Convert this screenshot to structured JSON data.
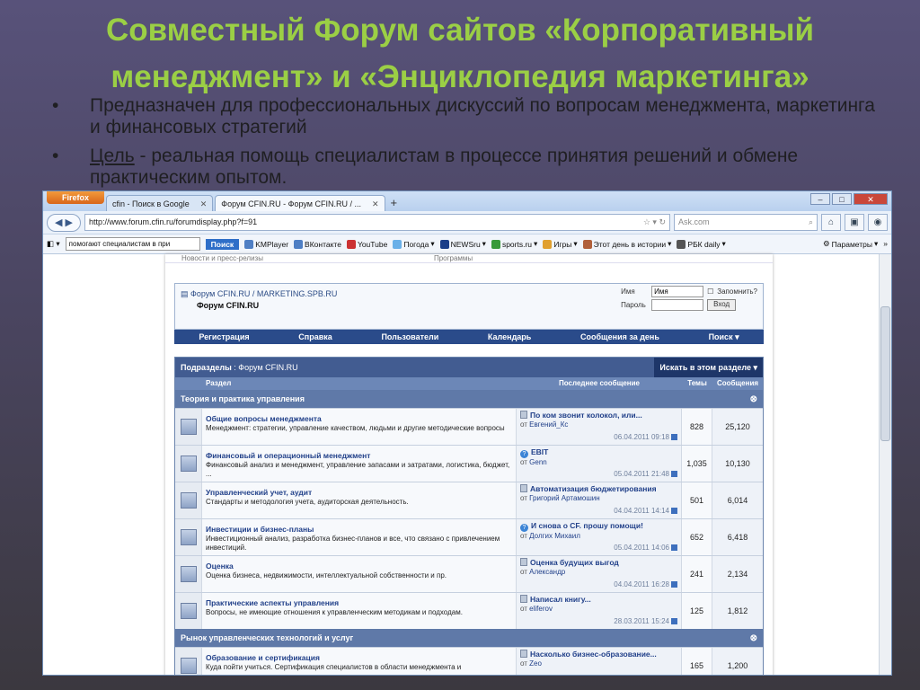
{
  "slide": {
    "title_line1": "Совместный Форум сайтов «Корпоративный",
    "title_line2": "менеджмент» и «Энциклопедия маркетинга»",
    "bullet1": "Предназначен для профессиональных дискуссий по вопросам менеджмента, маркетинга и финансовых стратегий",
    "bullet2_label": "Цель",
    "bullet2_text": " - реальная помощь специалистам в процессе принятия решений и обмене практическим опытом."
  },
  "browser": {
    "firefox_label": "Firefox",
    "tabs": [
      {
        "label": "cfin - Поиск в Google"
      },
      {
        "label": "Форум CFIN.RU - Форум CFIN.RU / ..."
      }
    ],
    "url": "http://www.forum.cfin.ru/forumdisplay.php?f=91",
    "search_placeholder": "Ask.com",
    "toolbar": {
      "search_value": "помогают специалистам в при",
      "search_button": "Поиск",
      "items": [
        "KMPlayer",
        "ВКонтакте",
        "YouTube",
        "Погода",
        "NEWSru",
        "sports.ru",
        "Игры",
        "Этот день в истории",
        "РБК daily"
      ],
      "params": "Параметры"
    }
  },
  "forum": {
    "top_tabs": [
      "Новости и пресс-релизы",
      "Программы"
    ],
    "path": "Форум CFIN.RU / MARKETING.SPB.RU",
    "current": "Форум CFIN.RU",
    "login": {
      "name_label": "Имя",
      "name_value": "Имя",
      "remember": "Запомнить?",
      "pass_label": "Пароль",
      "button": "Вход"
    },
    "menu": [
      "Регистрация",
      "Справка",
      "Пользователи",
      "Календарь",
      "Сообщения за день",
      "Поиск"
    ],
    "box_title": "Подразделы",
    "box_title_rest": ": Форум CFIN.RU",
    "search_in": "Искать в этом разделе",
    "columns": {
      "forum": "Раздел",
      "last": "Последнее сообщение",
      "topics": "Темы",
      "posts": "Сообщения"
    },
    "cat1": "Теория и практика управления",
    "cat2": "Рынок управленческих технологий и услуг",
    "rows": [
      {
        "title": "Общие вопросы менеджмента",
        "desc": "Менеджмент: стратегии, управление качеством, людьми и другие методические вопросы",
        "last_title": "По ком звонит колокол, или...",
        "by": "Евгений_Кс",
        "date": "06.04.2011",
        "time": "09:18",
        "topics": "828",
        "posts": "25,120",
        "icon": "note"
      },
      {
        "title": "Финансовый и операционный менеджмент",
        "desc": "Финансовый анализ и менеджмент, управление запасами и затратами, логистика, бюджет, ...",
        "last_title": "EBIT",
        "by": "Genn",
        "date": "05.04.2011",
        "time": "21:48",
        "topics": "1,035",
        "posts": "10,130",
        "icon": "q"
      },
      {
        "title": "Управленческий учет, аудит",
        "desc": "Стандарты и методология учета, аудиторская деятельность.",
        "last_title": "Автоматизация бюджетирования",
        "by": "Григорий Артамошин",
        "date": "04.04.2011",
        "time": "14:14",
        "topics": "501",
        "posts": "6,014",
        "icon": "note"
      },
      {
        "title": "Инвестиции и бизнес-планы",
        "desc": "Инвестиционный анализ, разработка бизнес-планов и все, что связано с привлечением инвестиций.",
        "last_title": "И снова о CF. прошу помощи!",
        "by": "Долгих Михаил",
        "date": "05.04.2011",
        "time": "14:06",
        "topics": "652",
        "posts": "6,418",
        "icon": "q"
      },
      {
        "title": "Оценка",
        "desc": "Оценка бизнеса, недвижимости, интеллектуальной собственности и пр.",
        "last_title": "Оценка будущих выгод",
        "by": "Александр",
        "date": "04.04.2011",
        "time": "16:28",
        "topics": "241",
        "posts": "2,134",
        "icon": "note"
      },
      {
        "title": "Практические аспекты управления",
        "desc": "Вопросы, не имеющие отношения к управленческим методикам и подходам.",
        "last_title": "Написал книгу...",
        "by": "eliferov",
        "date": "28.03.2011",
        "time": "15:24",
        "topics": "125",
        "posts": "1,812",
        "icon": "note"
      }
    ],
    "row_last": {
      "title": "Образование и сертификация",
      "desc": "Куда пойти учиться. Сертификация специалистов в области менеджмента и",
      "last_title": "Насколько бизнес-образование...",
      "by": "Zeo",
      "topics": "165",
      "posts": "1,200"
    }
  }
}
